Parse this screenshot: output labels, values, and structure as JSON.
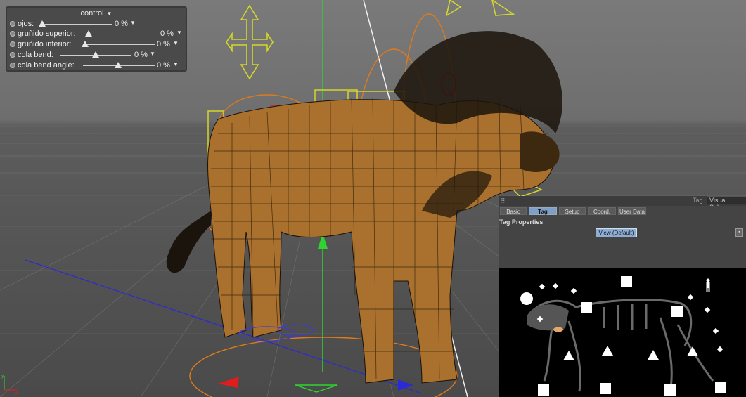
{
  "control": {
    "title": "control",
    "rows": [
      {
        "label": "ojos:",
        "value": "0 %",
        "level": 0
      },
      {
        "label": "gruñido superior:",
        "value": "0 %",
        "level": 0
      },
      {
        "label": "gruñido inferior:",
        "value": "0 %",
        "level": 0
      },
      {
        "label": "cola bend:",
        "value": "0 %",
        "level": 0.5
      },
      {
        "label": "cola bend angle:",
        "value": "0 %",
        "level": 0.5
      }
    ]
  },
  "attributes": {
    "mode_label": "Tag",
    "mode_value": "Visual Selector",
    "tabs": [
      {
        "label": "Basic",
        "active": false
      },
      {
        "label": "Tag",
        "active": true
      },
      {
        "label": "Setup",
        "active": false
      },
      {
        "label": "Coord.",
        "active": false
      },
      {
        "label": "User Data",
        "active": false
      }
    ],
    "section_title": "Tag Properties",
    "view_button": "View (Default)"
  },
  "icons": {
    "slider_knob": "triangle-knob-icon",
    "dropdown": "chevron-down-icon",
    "figure": "human-figure-icon",
    "lips": "lips-icon"
  },
  "colors": {
    "picker_bg": "#000000",
    "active_tab": "#7f9fc7",
    "rig_yellow": "#d6d62a",
    "rig_orange": "#e07a1a",
    "rig_red": "#d62222"
  }
}
